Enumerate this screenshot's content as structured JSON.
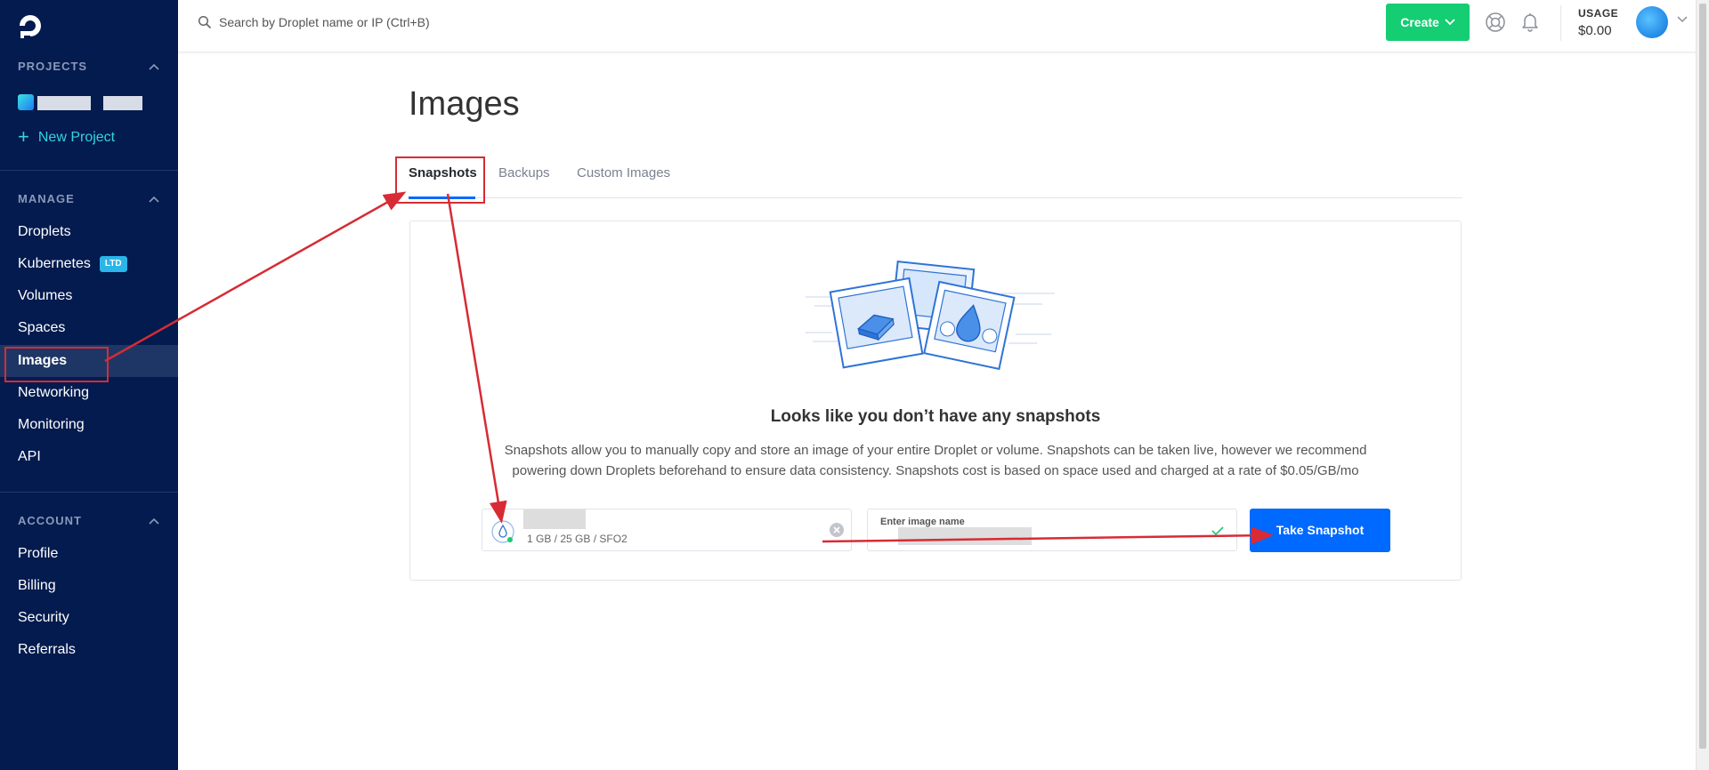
{
  "sidebar": {
    "projects_header": "PROJECTS",
    "new_project_label": "New Project",
    "manage_header": "MANAGE",
    "account_header": "ACCOUNT",
    "manage_items": [
      {
        "label": "Droplets"
      },
      {
        "label": "Kubernetes",
        "badge": "LTD"
      },
      {
        "label": "Volumes"
      },
      {
        "label": "Spaces"
      },
      {
        "label": "Images",
        "active": true
      },
      {
        "label": "Networking"
      },
      {
        "label": "Monitoring"
      },
      {
        "label": "API"
      }
    ],
    "account_items": [
      {
        "label": "Profile"
      },
      {
        "label": "Billing"
      },
      {
        "label": "Security"
      },
      {
        "label": "Referrals"
      }
    ]
  },
  "topbar": {
    "search_placeholder": "Search by Droplet name or IP (Ctrl+B)",
    "create_label": "Create",
    "usage_label": "USAGE",
    "usage_value": "$0.00"
  },
  "main": {
    "title": "Images",
    "tabs": [
      {
        "label": "Snapshots",
        "active": true
      },
      {
        "label": "Backups"
      },
      {
        "label": "Custom Images"
      }
    ],
    "empty_title": "Looks like you don’t have any snapshots",
    "empty_desc": "Snapshots allow you to manually copy and store an image of your entire Droplet or volume. Snapshots can be taken live, however we recommend powering down Droplets beforehand to ensure data consistency. Snapshots cost is based on space used and charged at a rate of $0.05/GB/mo",
    "droplet_specs": "1 GB / 25 GB / SFO2",
    "image_name_label": "Enter image name",
    "take_snapshot_label": "Take Snapshot"
  },
  "colors": {
    "sidebar_bg": "#031b4e",
    "accent_blue": "#0069ff",
    "create_green": "#15cd72",
    "annotation_red": "#d72b35"
  }
}
